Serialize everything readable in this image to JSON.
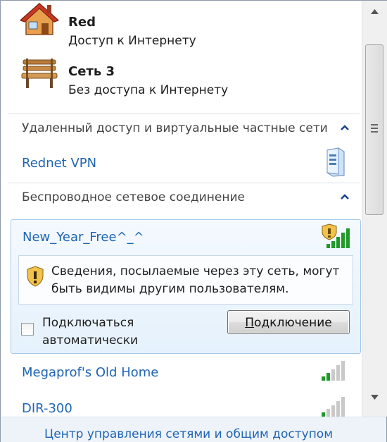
{
  "connected": [
    {
      "name": "Red",
      "status": "Доступ к Интернету",
      "icon": "home-network-icon"
    },
    {
      "name": "Сеть  3",
      "status": "Без доступа к Интернету",
      "icon": "park-bench-network-icon"
    }
  ],
  "sections": {
    "vpn": {
      "label": "Удаленный доступ и виртуальные частные сети",
      "items": [
        {
          "label": "Rednet VPN",
          "icon": "vpn-server-icon"
        }
      ]
    },
    "wireless": {
      "label": "Беспроводное сетевое соединение"
    }
  },
  "selected_network": {
    "name": "New_Year_Free^_^",
    "signal_bars": 5,
    "secured": false,
    "warning": "Сведения, посылаемые через эту сеть, могут быть видимы другим пользователям.",
    "auto_connect_label": "Подключаться автоматически",
    "auto_connect_checked": false,
    "connect_button": {
      "underlined": "П",
      "rest": "одключение"
    }
  },
  "wifi_list": [
    {
      "name": "Megaprof's Old Home",
      "signal_bars": 2
    },
    {
      "name": "DIR-300",
      "signal_bars": 1
    }
  ],
  "footer": {
    "link": "Центр управления сетями и общим доступом"
  },
  "colors": {
    "link": "#1f64b5",
    "selection_bg": "#e5f1fc",
    "signal_green": "#1f9a2a"
  }
}
